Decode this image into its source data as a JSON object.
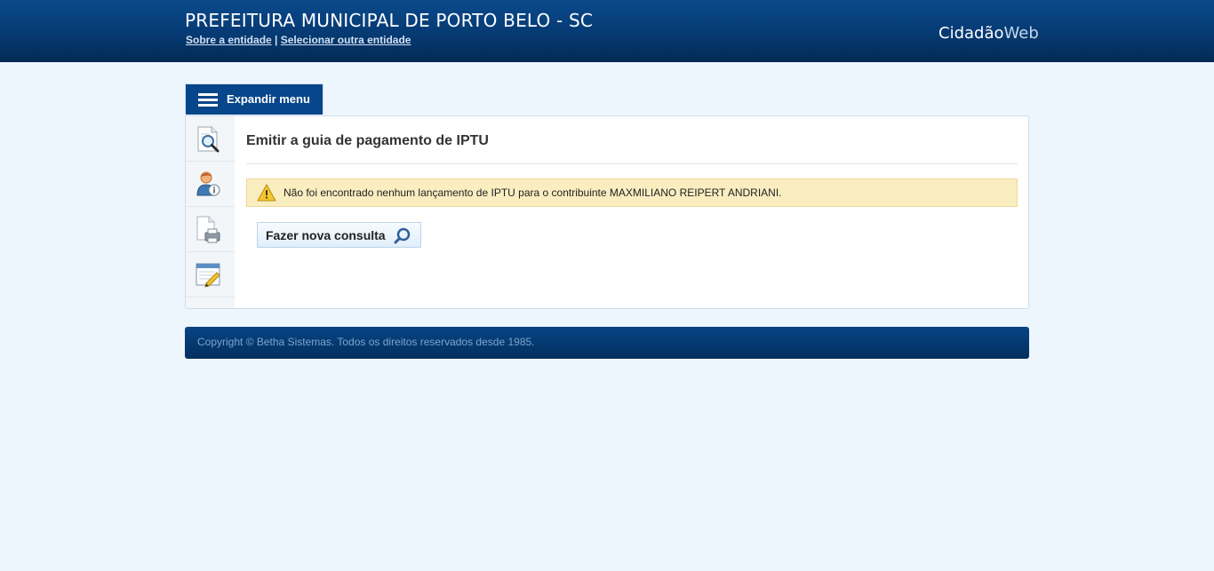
{
  "header": {
    "title": "PREFEITURA MUNICIPAL DE PORTO BELO - SC",
    "link_about": "Sobre a entidade",
    "link_separator": "|",
    "link_select": "Selecionar outra entidade",
    "brand_part1": "Cidadão",
    "brand_part2": "Web"
  },
  "menu": {
    "expand_label": "Expandir menu",
    "items": [
      {
        "icon": "document-search-icon"
      },
      {
        "icon": "user-info-icon"
      },
      {
        "icon": "document-print-icon"
      },
      {
        "icon": "notepad-edit-icon"
      }
    ]
  },
  "main": {
    "title": "Emitir a guia de pagamento de IPTU",
    "warning": {
      "icon": "warning-icon",
      "text": "Não foi encontrado nenhum lançamento de IPTU para o contribuinte MAXMILIANO REIPERT ANDRIANI."
    },
    "new_query_button": {
      "label": "Fazer nova consulta",
      "icon": "search-icon"
    }
  },
  "footer": {
    "copyright": "Copyright © Betha Sistemas. Todos os direitos reservados desde 1985."
  },
  "colors": {
    "header_bg": "#063a72",
    "page_bg": "#eef6fd",
    "warning_bg": "#faedc0",
    "footer_text": "#7fa3c9"
  }
}
